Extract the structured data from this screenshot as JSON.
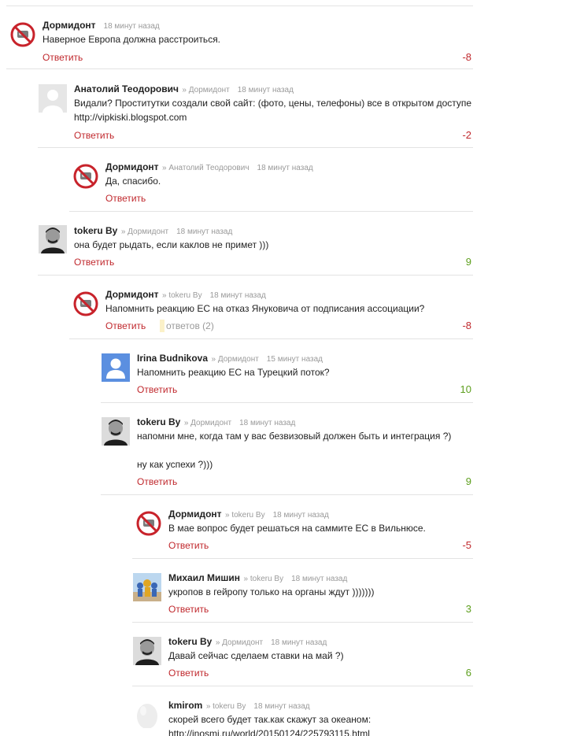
{
  "reply_label": "Ответить",
  "colors": {
    "link": "#c0282d",
    "positive": "#5c9e1c",
    "negative": "#c0282d",
    "divider": "#e3e3e3"
  },
  "comments": [
    {
      "author": "Дормидонт",
      "reply_to": "",
      "time": "18 минут назад",
      "lines": [
        "Наверное Европа должна расстроиться."
      ],
      "score": "-8",
      "avatar": "no-sign-avatar"
    },
    {
      "author": "Анатолий Теодорович",
      "reply_to": "» Дормидонт",
      "time": "18 минут назад",
      "lines": [
        "Видали? Проститутки создали свой сайт: (фото, цены, телефоны) все в открытом доступе",
        "http://vipkiski.blogspot.com"
      ],
      "score": "-2",
      "avatar": "default-avatar"
    },
    {
      "author": "Дормидонт",
      "reply_to": "» Анатолий Теодорович",
      "time": "18 минут назад",
      "lines": [
        "Да, спасибо."
      ],
      "score": "",
      "avatar": "no-sign-avatar"
    },
    {
      "author": "tokeru By",
      "reply_to": "» Дормидонт",
      "time": "18 минут назад",
      "lines": [
        "она будет рыдать, если каклов не примет )))"
      ],
      "score": "9",
      "avatar": "portrait-avatar"
    },
    {
      "author": "Дормидонт",
      "reply_to": "» tokeru By",
      "time": "18 минут назад",
      "lines": [
        "Напомнить реакцию ЕС на отказ Януковича от подписания ассоциации?"
      ],
      "score": "-8",
      "avatar": "no-sign-avatar",
      "answers": "ответов (2)"
    },
    {
      "author": "Irina Budnikova",
      "reply_to": "» Дормидонт",
      "time": "15 минут назад",
      "lines": [
        "Напомнить реакцию ЕС на Турецкий поток?"
      ],
      "score": "10",
      "avatar": "blue-user-avatar"
    },
    {
      "author": "tokeru By",
      "reply_to": "» Дормидонт",
      "time": "18 минут назад",
      "lines": [
        "напомни мне, когда там у вас безвизовый должен быть и интеграция ?)",
        "ну как успехи ?)))"
      ],
      "score": "9",
      "avatar": "portrait-avatar"
    },
    {
      "author": "Дормидонт",
      "reply_to": "» tokeru By",
      "time": "18 минут назад",
      "lines": [
        "В мае вопрос будет решаться на саммите ЕС в Вильнюсе."
      ],
      "score": "-5",
      "avatar": "no-sign-avatar"
    },
    {
      "author": "Михаил Мишин",
      "reply_to": "» tokeru By",
      "time": "18 минут назад",
      "lines": [
        "укропов в гейропу только на органы ждут )))))))"
      ],
      "score": "3",
      "avatar": "crowd-avatar"
    },
    {
      "author": "tokeru By",
      "reply_to": "» Дормидонт",
      "time": "18 минут назад",
      "lines": [
        "Давай сейчас сделаем ставки на май ?)"
      ],
      "score": "6",
      "avatar": "portrait-avatar"
    },
    {
      "author": "kmirom",
      "reply_to": "» tokeru By",
      "time": "18 минут назад",
      "lines": [
        "скорей всего будет так.как скажут за океаном:",
        "http://inosmi.ru/world/20150124/225793115.html"
      ],
      "score": "",
      "avatar": "egg-avatar"
    }
  ]
}
